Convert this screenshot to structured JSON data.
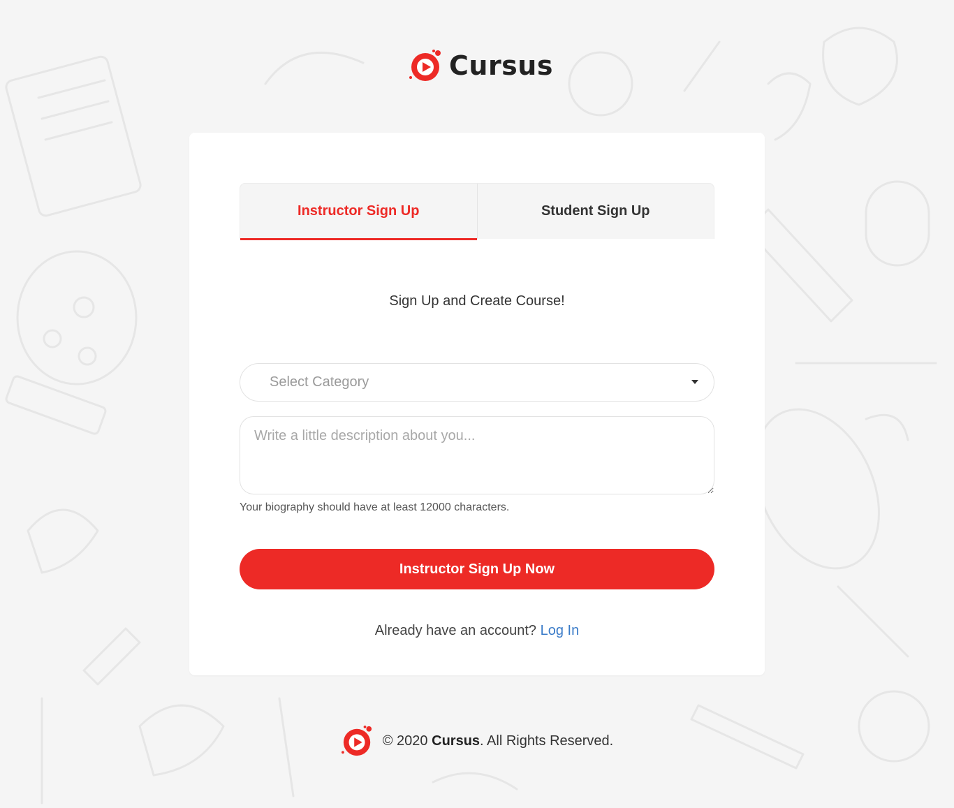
{
  "brand": {
    "name": "Cursus",
    "logo_icon": "cursus-play-logo-icon",
    "accent": "#ed2a26"
  },
  "tabs": [
    {
      "label": "Instructor Sign Up",
      "active": true
    },
    {
      "label": "Student Sign Up",
      "active": false
    }
  ],
  "form": {
    "subtitle": "Sign Up and Create Course!",
    "category_select": {
      "value": "Select Category",
      "icon": "caret-down-icon"
    },
    "bio": {
      "placeholder": "Write a little description about you...",
      "helper": "Your biography should have at least 12000 characters."
    },
    "submit_label": "Instructor Sign Up Now"
  },
  "login_prompt": {
    "text": "Already have an account?",
    "link": "Log In",
    "link_color": "#3a7bc8"
  },
  "footer": {
    "prefix": "© 2020",
    "brand": "Cursus",
    "suffix": ". All Rights Reserved."
  }
}
